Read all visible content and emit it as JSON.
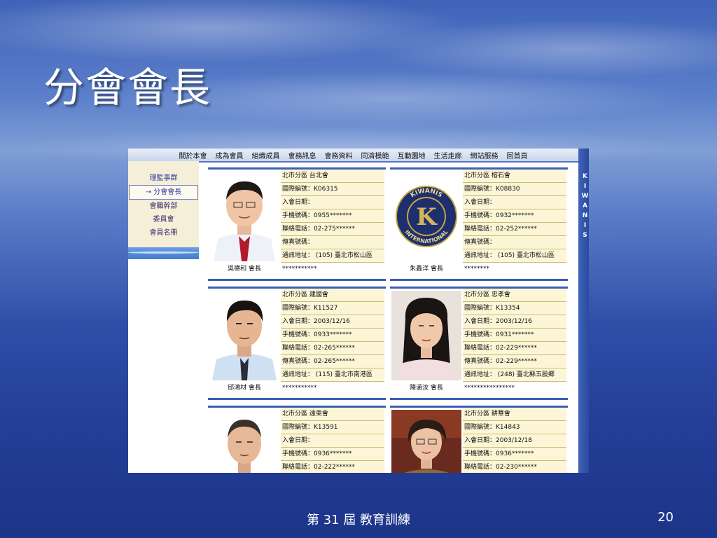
{
  "slide": {
    "title": "分會會長",
    "footer": "第 31 屆 教育訓練",
    "page_number": "20"
  },
  "nav": {
    "items": [
      "關於本會",
      "成為會員",
      "組織成員",
      "會務訊息",
      "會務資料",
      "同濟模範",
      "互動園地",
      "生活走廊",
      "網站服務",
      "回首頁"
    ]
  },
  "sidebar": {
    "items": [
      {
        "label": "理監事群",
        "active": false
      },
      {
        "label": "→ 分會會長",
        "active": true
      },
      {
        "label": "會職幹部",
        "active": false
      },
      {
        "label": "委員會",
        "active": false
      },
      {
        "label": "會員名冊",
        "active": false
      }
    ]
  },
  "brand_vertical": [
    "K",
    "I",
    "W",
    "A",
    "N",
    "I",
    "S"
  ],
  "logo": {
    "ring_text_top": "KIWANIS",
    "ring_text_bottom": "INTERNATIONAL",
    "center": "K"
  },
  "cards": [
    {
      "rows": [
        "北市分區 台北會",
        "國際編號：K06315",
        "入會日期：",
        "手機號碼：0955*******",
        "聯絡電話：02-275******",
        "傳真號碼：",
        "通訊地址： (105) 臺北市松山區"
      ],
      "leader": "吳德和  會長",
      "stars": "***********"
    },
    {
      "rows": [
        "北市分區 榕石會",
        "國際編號：K08830",
        "入會日期：",
        "手機號碼：0932*******",
        "聯絡電話：02-252******",
        "傳真號碼：",
        "通訊地址： (105) 臺北市松山區"
      ],
      "leader": "朱鑫洋  會長",
      "stars": "********"
    },
    {
      "rows": [
        "北市分區 建國會",
        "國際編號：K11527",
        "入會日期：2003/12/16",
        "手機號碼：0933*******",
        "聯絡電話：02-265******",
        "傳真號碼：02-265******",
        "通訊地址： (115) 臺北市南港區"
      ],
      "leader": "邱鴻材  會長",
      "stars": "***********"
    },
    {
      "rows": [
        "北市分區 忠孝會",
        "國際編號：K13354",
        "入會日期：2003/12/16",
        "手機號碼：0931*******",
        "聯絡電話：02-229******",
        "傳真號碼：02-229******",
        "通訊地址： (248) 臺北縣五股鄉"
      ],
      "leader": "陳涵汝  會長",
      "stars": "****************"
    },
    {
      "rows": [
        "北市分區 遠東會",
        "國際編號：K13591",
        "入會日期：",
        "手機號碼：0936*******",
        "聯絡電話：02-222******"
      ],
      "leader": "",
      "stars": ""
    },
    {
      "rows": [
        "北市分區 耕華會",
        "國際編號：K14843",
        "入會日期：2003/12/18",
        "手機號碼：0936*******",
        "聯絡電話：02-230******"
      ],
      "leader": "",
      "stars": ""
    }
  ]
}
